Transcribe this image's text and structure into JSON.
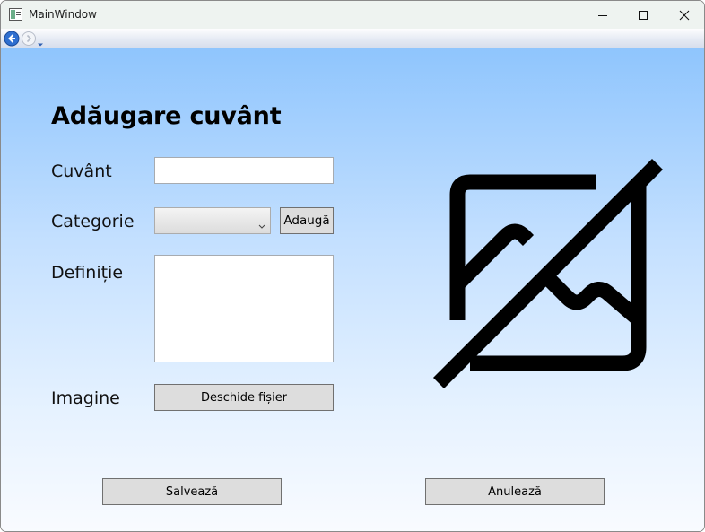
{
  "window": {
    "title": "MainWindow"
  },
  "form": {
    "heading": "Adăugare cuvânt",
    "word_label": "Cuvânt",
    "word_value": "",
    "category_label": "Categorie",
    "category_value": "",
    "add_category_label": "Adaugă",
    "definition_label": "Definiție",
    "definition_value": "",
    "image_label": "Imagine",
    "open_file_label": "Deschide fișier"
  },
  "actions": {
    "save_label": "Salvează",
    "cancel_label": "Anulează"
  },
  "icons": {
    "image_placeholder": "image-off-icon",
    "back": "back-arrow-icon",
    "forward": "forward-arrow-icon"
  },
  "colors": {
    "gradient_top": "#8fc5fd",
    "gradient_bottom": "#f9fbff",
    "button_face": "#dddddd"
  }
}
